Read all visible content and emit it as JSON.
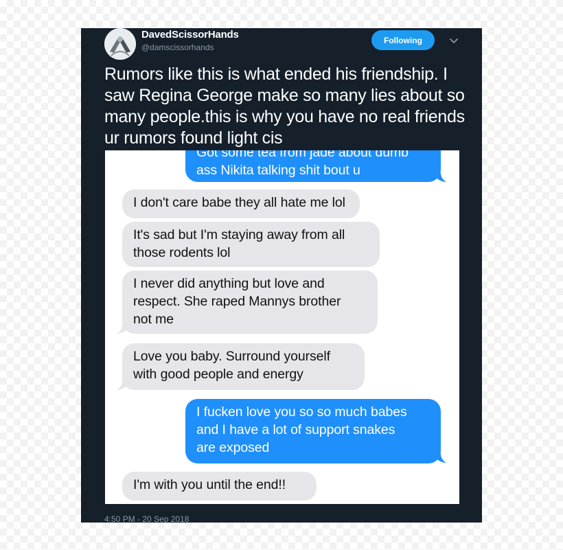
{
  "tweet": {
    "display_name": "DavedScissorHands",
    "handle": "@damscissorhands",
    "follow_label": "Following",
    "text": "Rumors like this is what ended his friendship. I saw Regina George make so many lies about so many people.this is why you have no real friends ur rumors found light cis",
    "timestamp": "4:50 PM - 20 Sep 2018"
  },
  "icons": {
    "avatar": "profile-avatar",
    "menu": "chevron-down-icon"
  },
  "colors": {
    "tweet_background": "#15202b",
    "follow_button": "#1d9bf0",
    "sent_bubble": "#1f8ffb",
    "received_bubble": "#e5e5ea"
  },
  "messages": [
    {
      "direction": "sent",
      "lines": [
        "Got some tea from jade about dumb",
        "ass Nikita talking shit bout u"
      ]
    },
    {
      "direction": "received",
      "lines": [
        "I don't care babe they all hate me lol"
      ]
    },
    {
      "direction": "received",
      "lines": [
        "It's sad but I'm staying away from all",
        "those rodents lol"
      ]
    },
    {
      "direction": "received",
      "lines": [
        "I never did anything but love and",
        "respect. She raped Mannys brother",
        "not me"
      ]
    },
    {
      "direction": "received",
      "lines": [
        "Love you baby. Surround yourself",
        "with good people and energy"
      ]
    },
    {
      "direction": "sent",
      "lines": [
        "I fucken love you so so much babes",
        "and I have a lot of support snakes",
        "are exposed"
      ]
    },
    {
      "direction": "received",
      "lines": [
        "I'm with you until the end!!"
      ]
    }
  ]
}
